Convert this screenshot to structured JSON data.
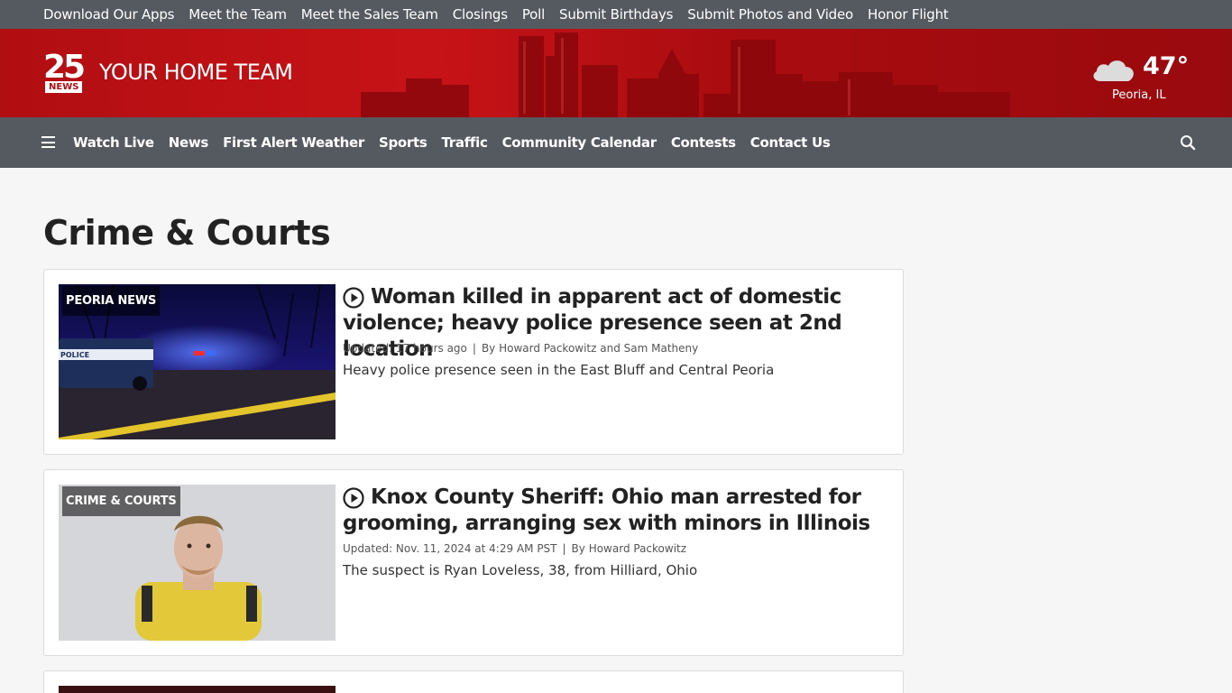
{
  "utility_nav": [
    "Download Our Apps",
    "Meet the Team",
    "Meet the Sales Team",
    "Closings",
    "Poll",
    "Submit Birthdays",
    "Submit Photos and Video",
    "Honor Flight"
  ],
  "brand": {
    "logo_number": "25",
    "logo_word": "NEWS",
    "tagline": "YOUR HOME TEAM"
  },
  "weather": {
    "temp": "47°",
    "location": "Peoria, IL",
    "icon": "cloud-icon"
  },
  "main_nav": [
    "Watch Live",
    "News",
    "First Alert Weather",
    "Sports",
    "Traffic",
    "Community Calendar",
    "Contests",
    "Contact Us"
  ],
  "page": {
    "title": "Crime & Courts"
  },
  "articles": [
    {
      "label": "PEORIA NEWS",
      "headline": "Woman killed in apparent act of domestic violence; heavy police presence seen at 2nd location",
      "updated": "Updated: 17 hours ago",
      "byline": "By Howard Packowitz and Sam Matheny",
      "description": "Heavy police presence seen in the East Bluff and Central Peoria"
    },
    {
      "label": "CRIME & COURTS",
      "headline": "Knox County Sheriff: Ohio man arrested for grooming, arranging sex with minors in Illinois",
      "updated": "Updated: Nov. 11, 2024 at 4:29 AM PST",
      "byline": "By Howard Packowitz",
      "description": "The suspect is Ryan Loveless, 38, from Hilliard, Ohio"
    }
  ],
  "colors": {
    "nav_gray": "#555a61",
    "brand_red": "#b10e12"
  }
}
